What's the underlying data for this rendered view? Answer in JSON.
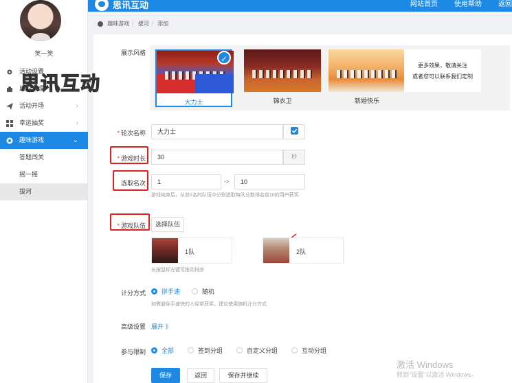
{
  "header": {
    "brand": "思讯互动",
    "nav": [
      "网站首页",
      "使用帮助",
      "返回"
    ]
  },
  "watermark_text": "思讯互动",
  "user": {
    "name": "笑一笑"
  },
  "sidebar": {
    "items": [
      {
        "label": "活动设置",
        "icon": "gear-icon"
      },
      {
        "label": "用户管理",
        "icon": "user-icon"
      },
      {
        "label": "活动开场",
        "icon": "send-icon",
        "chev": "›"
      },
      {
        "label": "幸运抽奖",
        "icon": "grid-icon",
        "chev": "›"
      },
      {
        "label": "趣味游戏",
        "icon": "game-icon",
        "chev": "⌄"
      }
    ],
    "subitems": [
      "答题闯关",
      "摇一摇",
      "拔河"
    ]
  },
  "breadcrumb": [
    "趣味游戏",
    "拔河",
    "添加"
  ],
  "form": {
    "style_label": "展示风格",
    "styles": [
      {
        "caption": "大力士",
        "selected": true
      },
      {
        "caption": "锦衣卫",
        "selected": false
      },
      {
        "caption": "新婚快乐",
        "selected": false
      }
    ],
    "more_line1": "更多效果，敬请关注",
    "more_line2": "或者您可以联系我们定制",
    "round_name_label": "轮次名称",
    "round_name_value": "大力士",
    "duration_label": "游戏时长",
    "duration_value": "30",
    "duration_unit": "秒",
    "rank_label": "选取名次",
    "rank_from": "1",
    "rank_to": "10",
    "rank_sep": "->",
    "rank_hint": "游戏结束后，从前1名的队伍中分别选取每队分数排名前10的用户获奖",
    "team_label": "游戏队伍",
    "team_button": "选择队伍",
    "teams": [
      {
        "name": "1队"
      },
      {
        "name": "2队"
      }
    ],
    "team_hint": "长按鼠标左键可拖动排序",
    "score_label": "计分方式",
    "score_options": [
      {
        "label": "拼手速",
        "checked": true
      },
      {
        "label": "随机",
        "checked": false
      }
    ],
    "score_hint": "如需避免手速快的人经常获奖，建议使用随机计分方式",
    "advanced_label": "高级设置",
    "advanced_link": "展开 》",
    "limit_label": "参与限制",
    "limit_options": [
      {
        "label": "全部",
        "checked": true
      },
      {
        "label": "签到分组",
        "checked": false
      },
      {
        "label": "自定义分组",
        "checked": false
      },
      {
        "label": "互动分组",
        "checked": false
      }
    ],
    "buttons": {
      "save": "保存",
      "back": "返回",
      "save_continue": "保存并继续"
    }
  },
  "os_watermark": {
    "line1": "激活 Windows",
    "line2": "转到\"设置\"以激活 Windows。"
  },
  "colors": {
    "accent": "#1e88e5",
    "highlight_box": "#e02020"
  }
}
